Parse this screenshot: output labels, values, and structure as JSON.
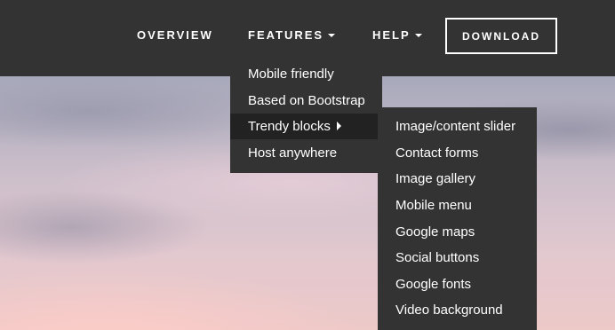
{
  "nav": {
    "items": [
      {
        "label": "OVERVIEW"
      },
      {
        "label": "FEATURES"
      },
      {
        "label": "HELP"
      }
    ],
    "download_label": "DOWNLOAD"
  },
  "features_menu": {
    "items": [
      {
        "label": "Mobile friendly"
      },
      {
        "label": "Based on Bootstrap"
      },
      {
        "label": "Trendy blocks"
      },
      {
        "label": "Host anywhere"
      }
    ]
  },
  "trendy_submenu": {
    "items": [
      {
        "label": "Image/content slider"
      },
      {
        "label": "Contact forms"
      },
      {
        "label": "Image gallery"
      },
      {
        "label": "Mobile menu"
      },
      {
        "label": "Google maps"
      },
      {
        "label": "Social buttons"
      },
      {
        "label": "Google fonts"
      },
      {
        "label": "Video background"
      }
    ]
  }
}
